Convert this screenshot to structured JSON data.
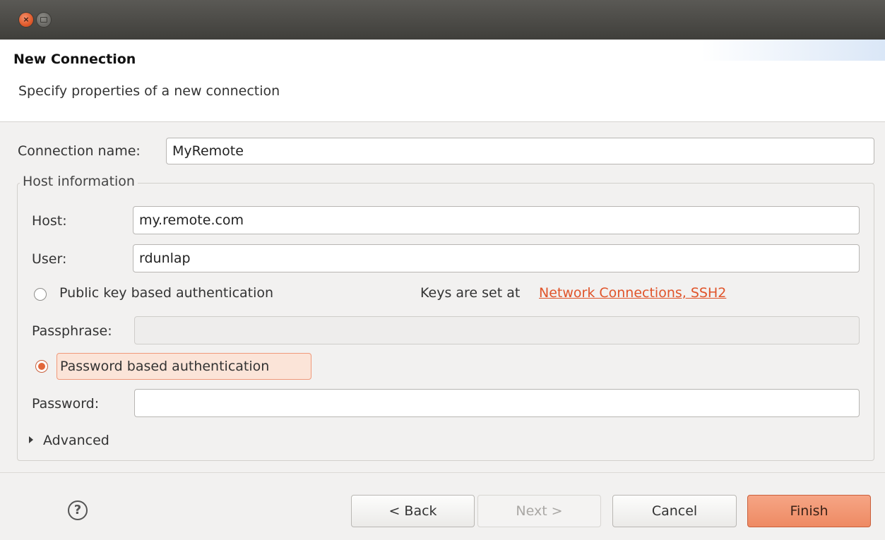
{
  "window": {
    "close_glyph": "×",
    "close_icon": "close-icon",
    "minimize_icon": "minimize-icon"
  },
  "header": {
    "title": "New Connection",
    "description": "Specify properties of a new connection"
  },
  "form": {
    "connection_name_label": "Connection name:",
    "connection_name_value": "MyRemote",
    "host_group_label": "Host information",
    "host_label": "Host:",
    "host_value": "my.remote.com",
    "user_label": "User:",
    "user_value": "rdunlap",
    "public_key_radio_label": "Public key based authentication",
    "public_key_selected": false,
    "keys_text": "Keys are set at",
    "keys_link": "Network Connections, SSH2",
    "passphrase_label": "Passphrase:",
    "passphrase_value": "",
    "password_radio_label": "Password based authentication",
    "password_selected": true,
    "password_label": "Password:",
    "password_value": "",
    "advanced_label": "Advanced",
    "advanced_expanded": false
  },
  "footer": {
    "help_glyph": "?",
    "back_label": "< Back",
    "next_label": "Next >",
    "cancel_label": "Cancel",
    "finish_label": "Finish"
  },
  "colors": {
    "accent": "#e2673a",
    "link": "#e0542a",
    "titlebar": "#4b4a46"
  }
}
